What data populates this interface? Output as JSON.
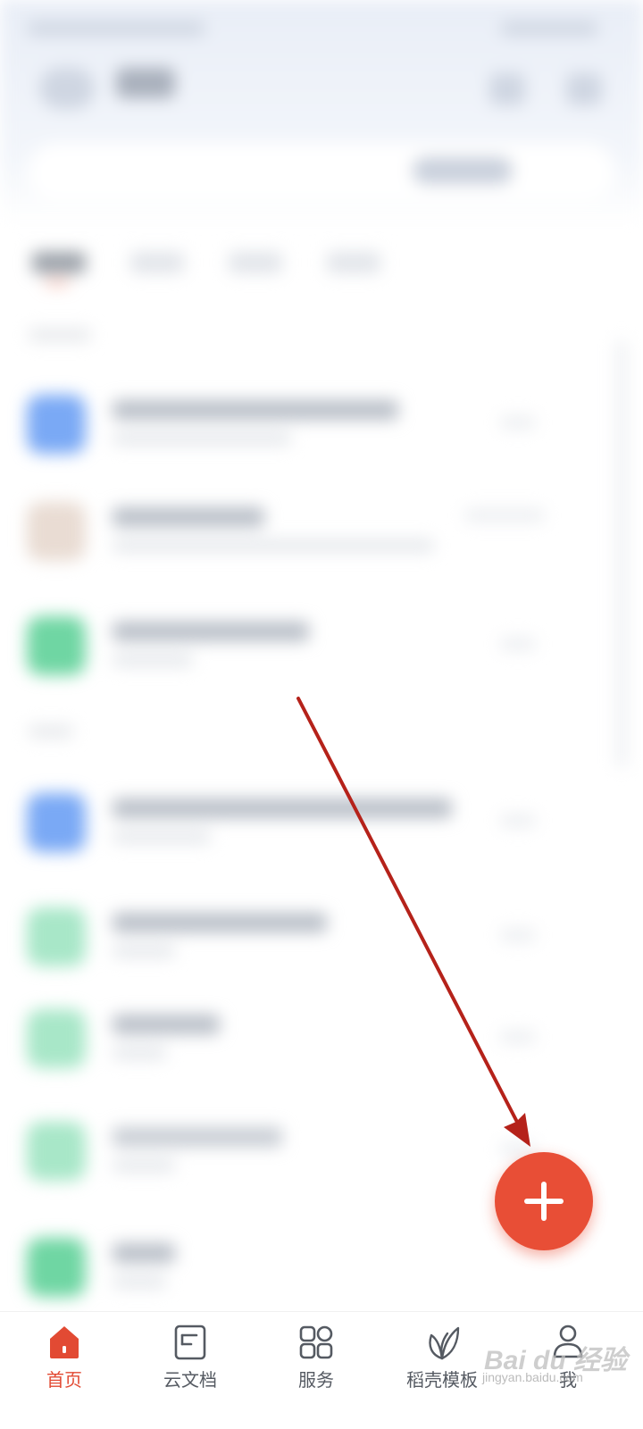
{
  "fab": {
    "icon": "plus-icon"
  },
  "bottom_nav": {
    "items": [
      {
        "label": "首页",
        "icon": "home-icon",
        "active": true
      },
      {
        "label": "云文档",
        "icon": "cloud-doc-icon",
        "active": false
      },
      {
        "label": "服务",
        "icon": "grid-apps-icon",
        "active": false
      },
      {
        "label": "稻壳模板",
        "icon": "leaf-template-icon",
        "active": false
      },
      {
        "label": "我",
        "icon": "user-icon",
        "active": false
      }
    ]
  },
  "watermark": {
    "text": "Bai du 经验",
    "url_text": "jingyan.baidu.com"
  },
  "colors": {
    "accent": "#e84e36",
    "annotation": "#b5221a",
    "nav_text": "#555a62"
  }
}
